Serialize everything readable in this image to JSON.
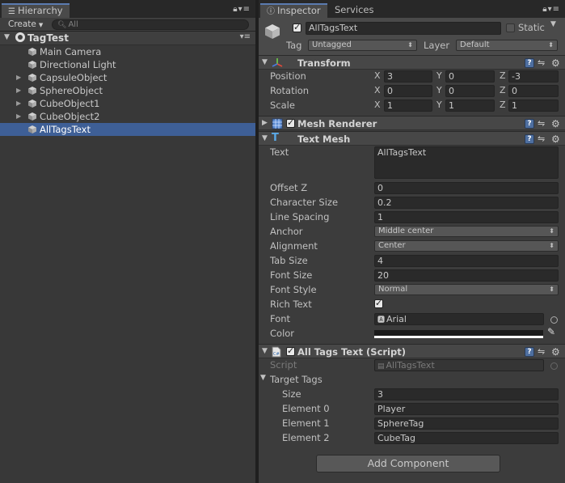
{
  "hierarchy": {
    "tab_label": "Hierarchy",
    "create_label": "Create",
    "search_placeholder": "All",
    "scene_name": "TagTest",
    "items": [
      {
        "label": "Main Camera",
        "expandable": false,
        "selected": false
      },
      {
        "label": "Directional Light",
        "expandable": false,
        "selected": false
      },
      {
        "label": "CapsuleObject",
        "expandable": true,
        "selected": false
      },
      {
        "label": "SphereObject",
        "expandable": true,
        "selected": false
      },
      {
        "label": "CubeObject1",
        "expandable": true,
        "selected": false
      },
      {
        "label": "CubeObject2",
        "expandable": true,
        "selected": false
      },
      {
        "label": "AllTagsText",
        "expandable": false,
        "selected": true
      }
    ]
  },
  "inspector": {
    "tab_label": "Inspector",
    "services_tab_label": "Services",
    "object": {
      "name": "AllTagsText",
      "active": true,
      "static_label": "Static",
      "static": false,
      "tag_label": "Tag",
      "tag_value": "Untagged",
      "layer_label": "Layer",
      "layer_value": "Default"
    },
    "transform": {
      "title": "Transform",
      "rows": [
        {
          "label": "Position",
          "x": "3",
          "y": "0",
          "z": "-3"
        },
        {
          "label": "Rotation",
          "x": "0",
          "y": "0",
          "z": "0"
        },
        {
          "label": "Scale",
          "x": "1",
          "y": "1",
          "z": "1"
        }
      ],
      "axis_x": "X",
      "axis_y": "Y",
      "axis_z": "Z"
    },
    "mesh_renderer": {
      "title": "Mesh Renderer",
      "enabled": true
    },
    "text_mesh": {
      "title": "Text Mesh",
      "text_label": "Text",
      "text_value": "AllTagsText",
      "offset_z_label": "Offset Z",
      "offset_z": "0",
      "character_size_label": "Character Size",
      "character_size": "0.2",
      "line_spacing_label": "Line Spacing",
      "line_spacing": "1",
      "anchor_label": "Anchor",
      "anchor": "Middle center",
      "alignment_label": "Alignment",
      "alignment": "Center",
      "tab_size_label": "Tab Size",
      "tab_size": "4",
      "font_size_label": "Font Size",
      "font_size": "20",
      "font_style_label": "Font Style",
      "font_style": "Normal",
      "rich_text_label": "Rich Text",
      "rich_text": true,
      "font_label": "Font",
      "font": "Arial",
      "color_label": "Color",
      "color_value": "#ffffff"
    },
    "script_component": {
      "title": "All Tags Text (Script)",
      "enabled": true,
      "script_label": "Script",
      "script_value": "AllTagsText",
      "target_tags_label": "Target Tags",
      "size_label": "Size",
      "size": "3",
      "elements": [
        {
          "label": "Element 0",
          "value": "Player"
        },
        {
          "label": "Element 1",
          "value": "SphereTag"
        },
        {
          "label": "Element 2",
          "value": "CubeTag"
        }
      ]
    },
    "add_component_label": "Add Component"
  }
}
